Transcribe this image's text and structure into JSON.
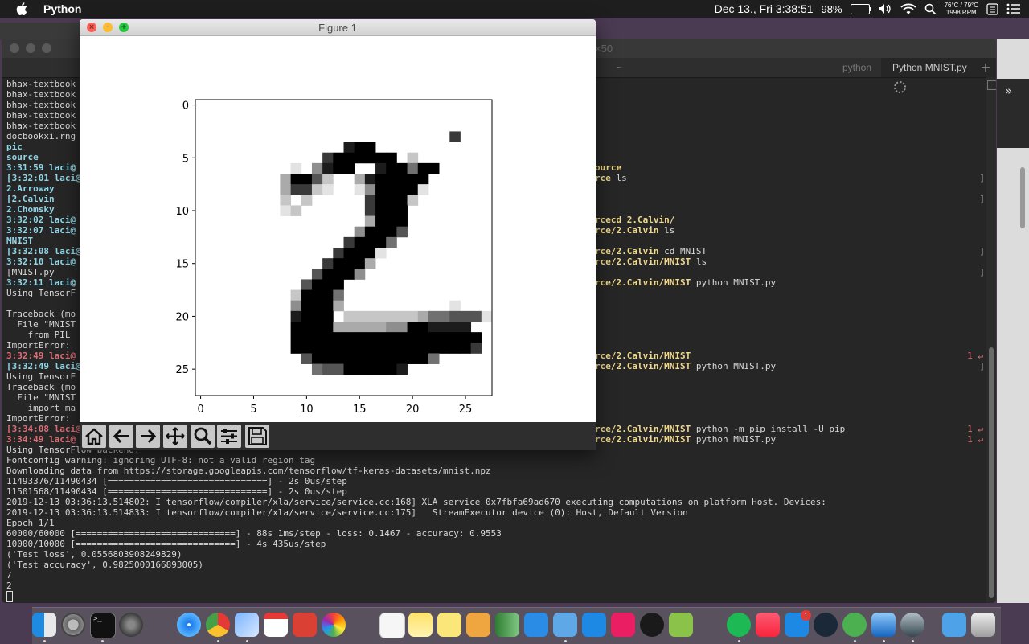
{
  "menubar": {
    "app_name": "Python",
    "clock": "Dec 13., Fri  3:38:51",
    "battery": "98%",
    "temp": "76°C / 79°C",
    "fan": "1998 RPM"
  },
  "terminal": {
    "title": "×50",
    "tabs": [
      {
        "label": "~"
      },
      {
        "label": "python"
      },
      {
        "label": "Python MNIST.py"
      }
    ],
    "new_tab_label": "+",
    "left_lines": [
      {
        "text": "bhax-textbook",
        "style": "plain"
      },
      {
        "text": "bhax-textbook",
        "style": "plain"
      },
      {
        "text": "bhax-textbook",
        "style": "plain"
      },
      {
        "text": "bhax-textbook",
        "style": "plain"
      },
      {
        "text": "bhax-textbook",
        "style": "plain"
      },
      {
        "text": "docbookxi.rng",
        "style": "plain"
      },
      {
        "text": "pic",
        "style": "cyan"
      },
      {
        "text": "source",
        "style": "cyan"
      },
      {
        "text": "3:31:59 laci@",
        "style": "cyan"
      },
      {
        "text": "[3:32:01 laci@",
        "style": "cyan"
      },
      {
        "text": "2.Arroway",
        "style": "cyan"
      },
      {
        "text": "[2.Calvin",
        "style": "cyan"
      },
      {
        "text": "2.Chomsky",
        "style": "cyan"
      },
      {
        "text": "3:32:02 laci@",
        "style": "cyan"
      },
      {
        "text": "3:32:07 laci@",
        "style": "cyan"
      },
      {
        "text": "MNIST",
        "style": "cyan"
      },
      {
        "text": "[3:32:08 laci@",
        "style": "cyan"
      },
      {
        "text": "3:32:10 laci@",
        "style": "cyan"
      },
      {
        "text": "[MNIST.py",
        "style": "plain"
      },
      {
        "text": "3:32:11 laci@",
        "style": "cyan"
      },
      {
        "text": "Using TensorF",
        "style": "plain"
      },
      {
        "text": "",
        "style": "plain"
      },
      {
        "text": "Traceback (mo",
        "style": "plain"
      },
      {
        "text": "  File \"MNIST",
        "style": "plain"
      },
      {
        "text": "    from PIL",
        "style": "plain"
      },
      {
        "text": "ImportError:",
        "style": "plain"
      },
      {
        "text": "3:32:49 laci@",
        "style": "red"
      },
      {
        "text": "[3:32:49 laci@",
        "style": "cyan"
      },
      {
        "text": "Using TensorF",
        "style": "plain"
      },
      {
        "text": "Traceback (mo",
        "style": "plain"
      },
      {
        "text": "  File \"MNIST",
        "style": "plain"
      },
      {
        "text": "    import ma",
        "style": "plain"
      },
      {
        "text": "ImportError:",
        "style": "plain"
      },
      {
        "text": "[3:34:08 laci@",
        "style": "red"
      },
      {
        "text": "3:34:49 laci@",
        "style": "red"
      }
    ],
    "bottom_lines": [
      "Using TensorFlow backend.",
      "Fontconfig warning: ignoring UTF-8: not a valid region tag",
      "Downloading data from https://storage.googleapis.com/tensorflow/tf-keras-datasets/mnist.npz",
      "11493376/11490434 [==============================] - 2s 0us/step",
      "11501568/11490434 [==============================] - 2s 0us/step",
      "2019-12-13 03:36:13.514802: I tensorflow/compiler/xla/service/service.cc:168] XLA service 0x7fbfa69ad670 executing computations on platform Host. Devices:",
      "2019-12-13 03:36:13.514833: I tensorflow/compiler/xla/service/service.cc:175]   StreamExecutor device (0): Host, Default Version",
      "Epoch 1/1",
      "60000/60000 [==============================] - 88s 1ms/step - loss: 0.1467 - accuracy: 0.9553",
      "10000/10000 [==============================] - 4s 435us/step",
      "('Test loss', 0.0556803908249829)",
      "('Test accuracy', 0.9825000166893005)",
      "7",
      "2"
    ],
    "right_lines": [
      {
        "path": "ource",
        "cmd": ""
      },
      {
        "path": "rce",
        "cmd": " ls"
      },
      {
        "path": "rcecd 2.Calvin/",
        "cmd": ""
      },
      {
        "path": "rce/2.Calvin",
        "cmd": " ls"
      },
      {
        "path": "rce/2.Calvin",
        "cmd": " cd MNIST"
      },
      {
        "path": "rce/2.Calvin/MNIST",
        "cmd": " ls"
      },
      {
        "path": "rce/2.Calvin/MNIST",
        "cmd": " python MNIST.py"
      },
      {
        "path": "rce/2.Calvin/MNIST",
        "cmd": ""
      },
      {
        "path": "rce/2.Calvin/MNIST",
        "cmd": " python MNIST.py"
      },
      {
        "path": "rce/2.Calvin/MNIST",
        "cmd": " python -m pip install -U pip"
      },
      {
        "path": "rce/2.Calvin/MNIST",
        "cmd": " python MNIST.py"
      }
    ],
    "exit_code": "1 ↵",
    "bracket": "]"
  },
  "figure": {
    "title": "Figure 1",
    "y_ticks": [
      "0",
      "5",
      "10",
      "15",
      "20",
      "25"
    ],
    "x_ticks": [
      "0",
      "5",
      "10",
      "15",
      "20",
      "25"
    ],
    "digit_rows": [
      "",
      "",
      "",
      "..........................",
      "................",
      "",
      "",
      "",
      "",
      "",
      "",
      "",
      "",
      "",
      "",
      "",
      "",
      "",
      "",
      "",
      "",
      "",
      "",
      "",
      "",
      "",
      "",
      ""
    ]
  },
  "colors": {
    "terminal_bg": "#262626",
    "prompt_cyan": "#8ed7e8",
    "error_red": "#e06c75",
    "path_yellow": "#f0d98b"
  }
}
